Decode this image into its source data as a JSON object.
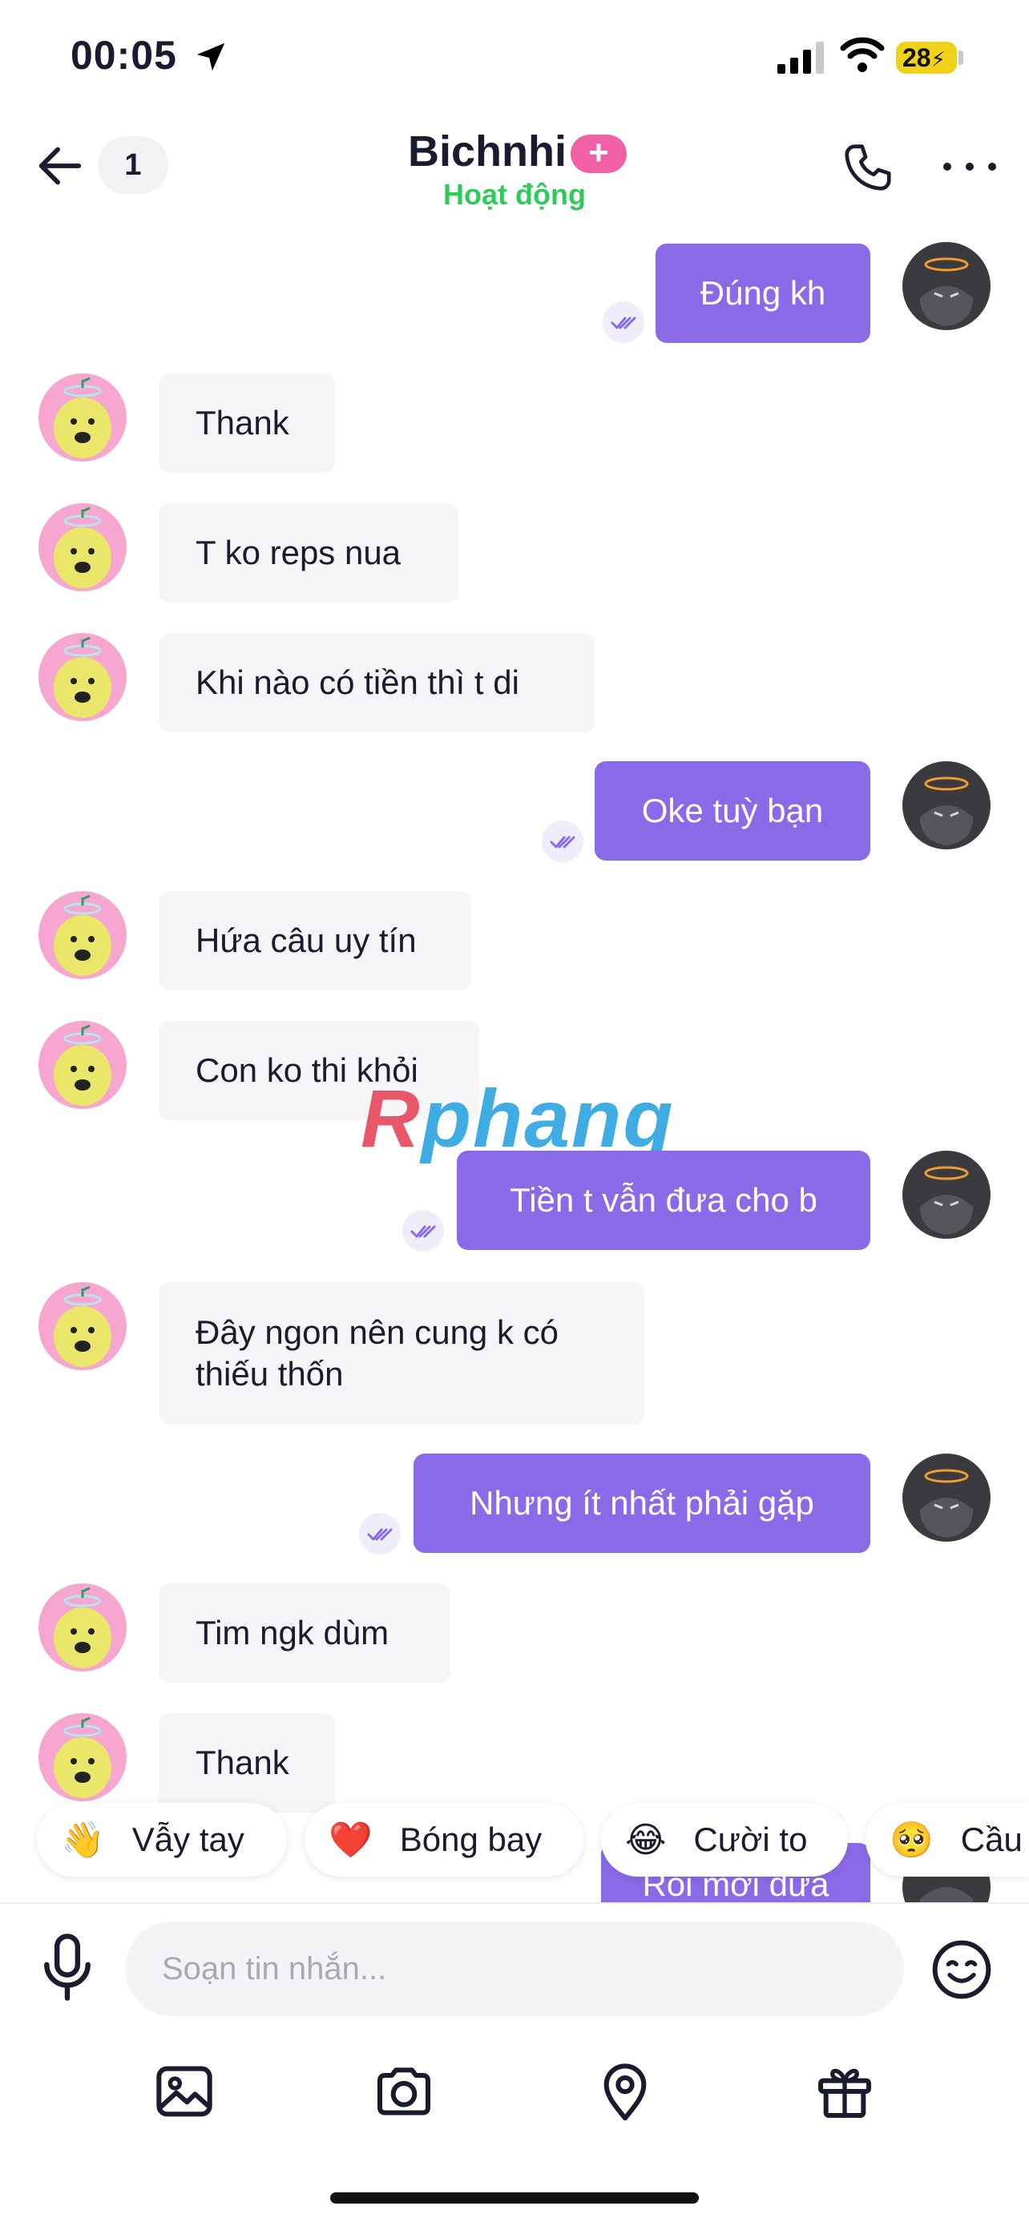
{
  "status_bar": {
    "time": "00:05",
    "battery": "28"
  },
  "header": {
    "unread_count": "1",
    "contact_name": "Bichnhi",
    "plus_badge": "+",
    "status": "Hoạt động"
  },
  "messages": [
    {
      "side": "out",
      "text": "Đúng kh"
    },
    {
      "side": "in",
      "text": "Thank"
    },
    {
      "side": "in",
      "text": "T ko reps nua"
    },
    {
      "side": "in",
      "text": "Khi nào có tiền thì t di"
    },
    {
      "side": "out",
      "text": "Oke tuỳ bạn"
    },
    {
      "side": "in",
      "text": "Hứa câu uy tín"
    },
    {
      "side": "in",
      "text": "Con ko thi khỏi"
    },
    {
      "side": "out",
      "text": "Tiền t vẫn đưa cho b"
    },
    {
      "side": "in",
      "text_line1": "Đây ngon nên cung k có",
      "text_line2": "thiếu thốn"
    },
    {
      "side": "out",
      "text": "Nhưng ít nhất phải gặp"
    },
    {
      "side": "in",
      "text": "Tim ngk dùm"
    },
    {
      "side": "in",
      "text": "Thank"
    },
    {
      "side": "out",
      "text": "Rồi mới đưa"
    }
  ],
  "watermark": {
    "first": "R",
    "rest": "phang"
  },
  "quick_reactions": [
    {
      "emoji": "👋",
      "label": "Vẫy tay"
    },
    {
      "emoji": "❤️",
      "label": "Bóng bay"
    },
    {
      "emoji": "😂",
      "label": "Cười to"
    },
    {
      "emoji": "🥺",
      "label": "Cầu"
    }
  ],
  "composer": {
    "placeholder": "Soạn tin nhắn..."
  },
  "colors": {
    "outgoing_bubble": "#8b6ae8",
    "incoming_bubble": "#f5f5f8",
    "online_status": "#2fcb5a",
    "plus_badge": "#f15fa5"
  },
  "icons": [
    "back-arrow-icon",
    "phone-icon",
    "more-icon",
    "mic-icon",
    "emoji-icon",
    "image-icon",
    "camera-icon",
    "location-icon",
    "gift-icon",
    "double-check-icon"
  ]
}
